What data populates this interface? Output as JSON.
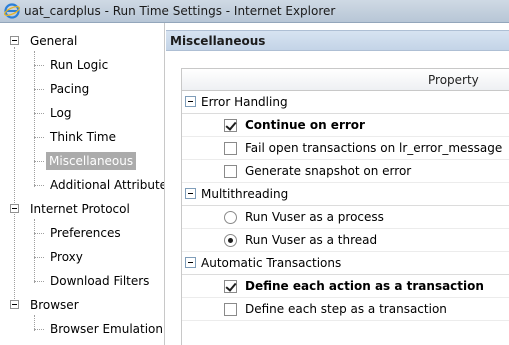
{
  "window": {
    "title": "uat_cardplus - Run Time Settings - Internet Explorer"
  },
  "tree": {
    "groups": [
      {
        "label": "General",
        "items": [
          "Run Logic",
          "Pacing",
          "Log",
          "Think Time",
          "Miscellaneous",
          "Additional Attributes"
        ]
      },
      {
        "label": "Internet Protocol",
        "items": [
          "Preferences",
          "Proxy",
          "Download Filters"
        ]
      },
      {
        "label": "Browser",
        "items": [
          "Browser Emulation"
        ]
      }
    ],
    "selected": "Miscellaneous"
  },
  "panel": {
    "title": "Miscellaneous",
    "column_header": "Property",
    "groups": [
      {
        "label": "Error Handling",
        "options": [
          {
            "label": "Continue on error",
            "type": "checkbox",
            "checked": true
          },
          {
            "label": "Fail open transactions on lr_error_message",
            "type": "checkbox",
            "checked": false
          },
          {
            "label": "Generate snapshot on error",
            "type": "checkbox",
            "checked": false
          }
        ]
      },
      {
        "label": "Multithreading",
        "options": [
          {
            "label": "Run Vuser as a process",
            "type": "radio",
            "checked": false
          },
          {
            "label": "Run Vuser as a thread",
            "type": "radio",
            "checked": true
          }
        ]
      },
      {
        "label": "Automatic Transactions",
        "options": [
          {
            "label": "Define each action as a transaction",
            "type": "checkbox",
            "checked": true
          },
          {
            "label": "Define each step as a transaction",
            "type": "checkbox",
            "checked": false
          }
        ]
      }
    ]
  }
}
